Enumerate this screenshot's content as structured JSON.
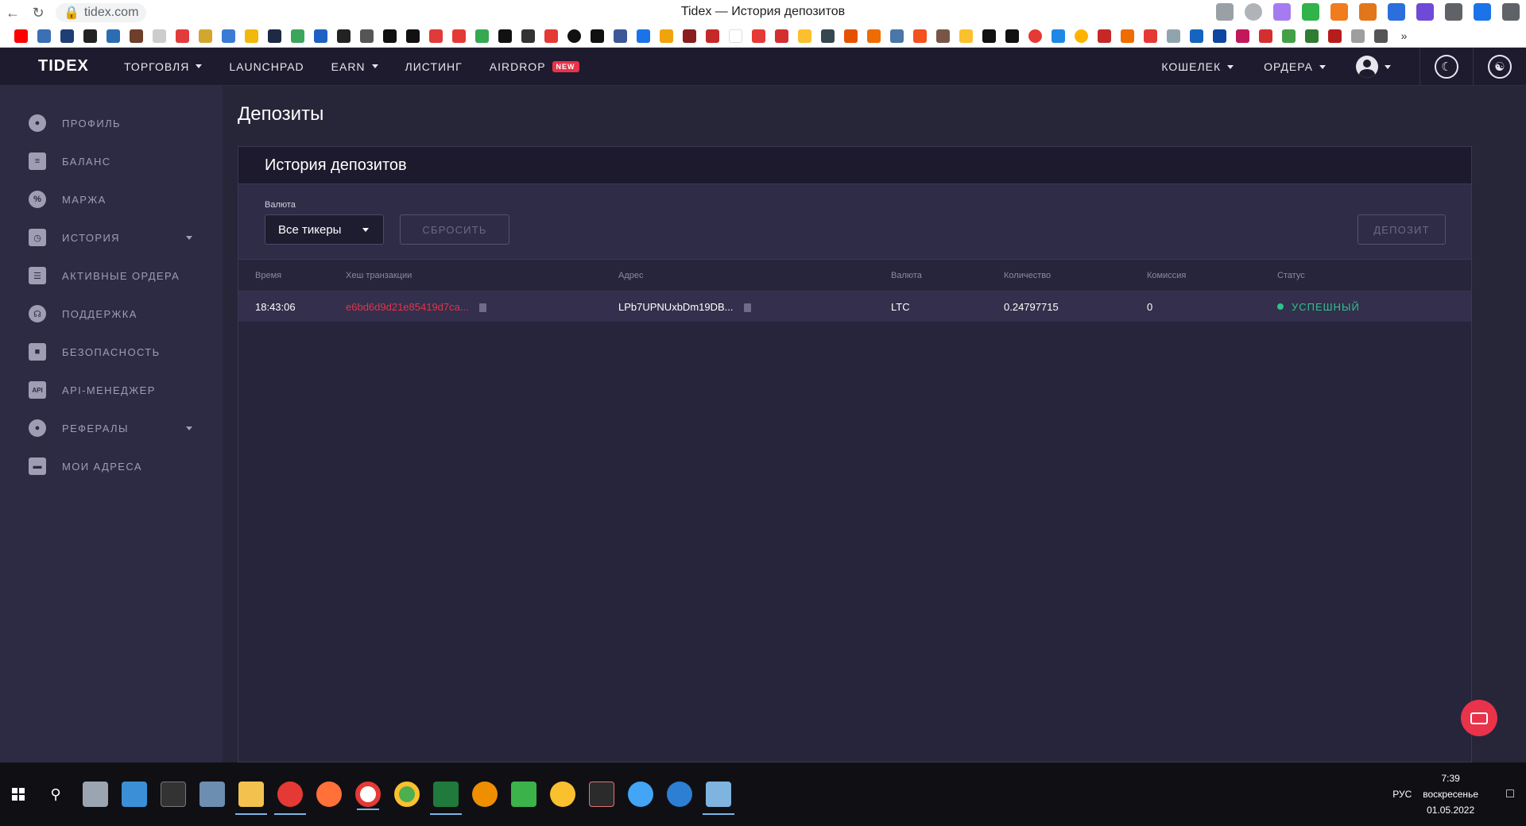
{
  "browser": {
    "url": "tidex.com",
    "tab_title": "Tidex — История депозитов"
  },
  "header": {
    "logo": "TIDEX",
    "menu": [
      {
        "label": "ТОРГОВЛЯ"
      },
      {
        "label": "LAUNCHPAD"
      },
      {
        "label": "EARN"
      },
      {
        "label": "ЛИСТИНГ"
      },
      {
        "label": "AIRDROP",
        "badge": "NEW"
      }
    ],
    "right": {
      "wallet": "КОШЕЛЕК",
      "orders": "ОРДЕРА"
    }
  },
  "sidebar": {
    "items": [
      {
        "label": "ПРОФИЛЬ",
        "icon": "user-icon"
      },
      {
        "label": "БАЛАНС",
        "icon": "balance-icon"
      },
      {
        "label": "МАРЖА",
        "icon": "percent-icon"
      },
      {
        "label": "ИСТОРИЯ",
        "icon": "history-icon"
      },
      {
        "label": "АКТИВНЫЕ ОРДЕРА",
        "icon": "orders-icon"
      },
      {
        "label": "ПОДДЕРЖКА",
        "icon": "support-icon"
      },
      {
        "label": "БЕЗОПАСНОСТЬ",
        "icon": "shield-icon"
      },
      {
        "label": "API-МЕНЕДЖЕР",
        "icon": "api-icon"
      },
      {
        "label": "РЕФЕРАЛЫ",
        "icon": "referrals-icon"
      },
      {
        "label": "МОИ АДРЕСА",
        "icon": "wallet-icon"
      }
    ]
  },
  "page": {
    "title": "Депозиты",
    "card_title": "История депозитов",
    "filter_label": "Валюта",
    "select_value": "Все тикеры",
    "reset_label": "СБРОСИТЬ",
    "deposit_label": "ДЕПОЗИТ"
  },
  "table": {
    "columns": [
      "Время",
      "Хеш транзакции",
      "Адрес",
      "Валюта",
      "Количество",
      "Комиссия",
      "Статус"
    ],
    "rows": [
      {
        "time": "18:43:06",
        "hash": "e6bd6d9d21e85419d7ca...",
        "address": "LPb7UPNUxbDm19DB...",
        "currency": "LTC",
        "amount": "0.24797715",
        "fee": "0",
        "status": "УСПЕШНЫЙ"
      }
    ]
  },
  "taskbar": {
    "lang": "РУС",
    "time": "7:39",
    "day": "воскресенье",
    "date": "01.05.2022"
  },
  "colors": {
    "accent": "#e8334a",
    "success": "#2fc18c",
    "bg": "#272538",
    "sidebar": "#2d2a44"
  }
}
